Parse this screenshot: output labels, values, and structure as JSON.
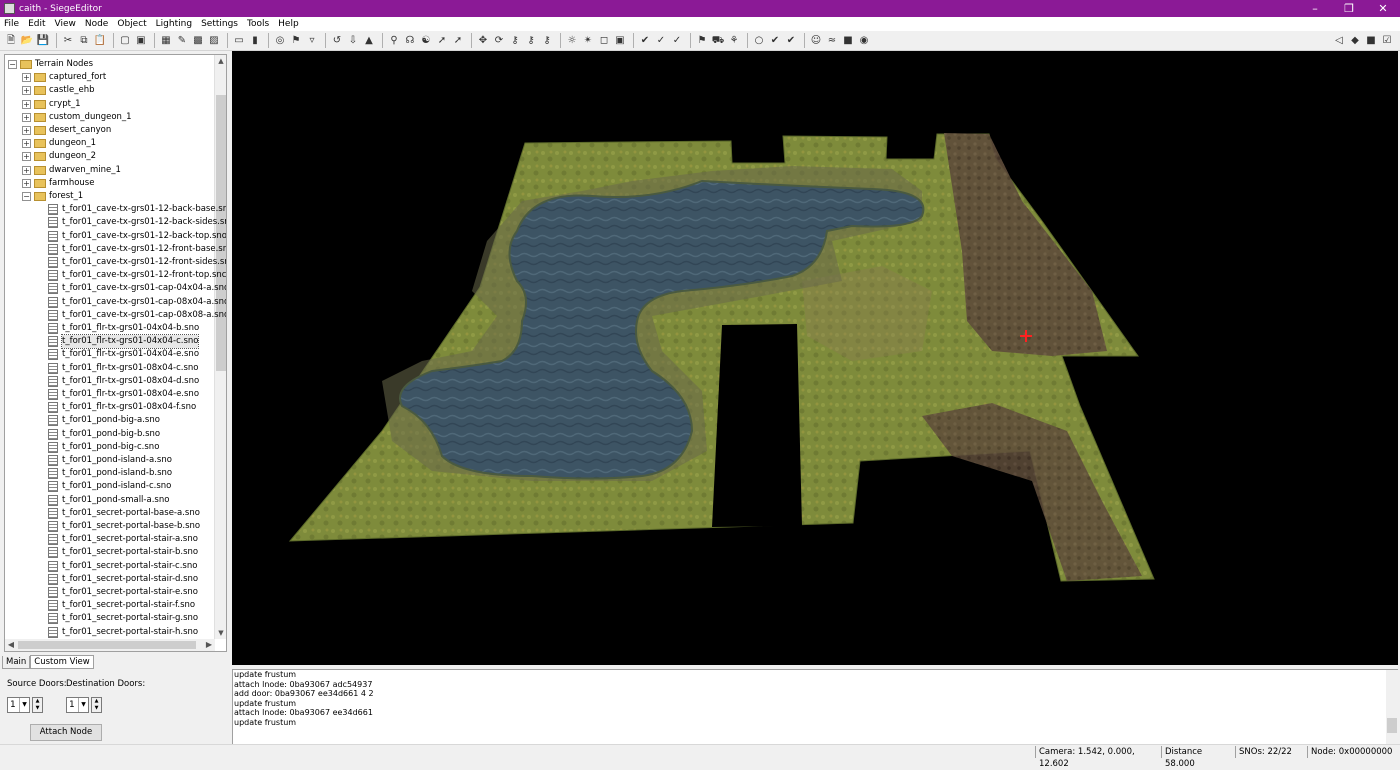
{
  "window": {
    "title": "caith - SiegeEditor"
  },
  "menu": [
    "File",
    "Edit",
    "View",
    "Node",
    "Object",
    "Lighting",
    "Settings",
    "Tools",
    "Help"
  ],
  "tree": {
    "root": "Terrain Nodes",
    "folders": [
      "captured_fort",
      "castle_ehb",
      "crypt_1",
      "custom_dungeon_1",
      "desert_canyon",
      "dungeon_1",
      "dungeon_2",
      "dwarven_mine_1",
      "farmhouse"
    ],
    "open_folder": "forest_1",
    "files": [
      "t_for01_cave-tx-grs01-12-back-base.sn",
      "t_for01_cave-tx-grs01-12-back-sides.sr",
      "t_for01_cave-tx-grs01-12-back-top.sno",
      "t_for01_cave-tx-grs01-12-front-base.sn",
      "t_for01_cave-tx-grs01-12-front-sides.sr",
      "t_for01_cave-tx-grs01-12-front-top.snc",
      "t_for01_cave-tx-grs01-cap-04x04-a.sno",
      "t_for01_cave-tx-grs01-cap-08x04-a.sno",
      "t_for01_cave-tx-grs01-cap-08x08-a.sno",
      "t_for01_flr-tx-grs01-04x04-b.sno",
      "t_for01_flr-tx-grs01-04x04-c.sno",
      "t_for01_flr-tx-grs01-04x04-e.sno",
      "t_for01_flr-tx-grs01-08x04-c.sno",
      "t_for01_flr-tx-grs01-08x04-d.sno",
      "t_for01_flr-tx-grs01-08x04-e.sno",
      "t_for01_flr-tx-grs01-08x04-f.sno",
      "t_for01_pond-big-a.sno",
      "t_for01_pond-big-b.sno",
      "t_for01_pond-big-c.sno",
      "t_for01_pond-island-a.sno",
      "t_for01_pond-island-b.sno",
      "t_for01_pond-island-c.sno",
      "t_for01_pond-small-a.sno",
      "t_for01_secret-portal-base-a.sno",
      "t_for01_secret-portal-base-b.sno",
      "t_for01_secret-portal-stair-a.sno",
      "t_for01_secret-portal-stair-b.sno",
      "t_for01_secret-portal-stair-c.sno",
      "t_for01_secret-portal-stair-d.sno",
      "t_for01_secret-portal-stair-e.sno",
      "t_for01_secret-portal-stair-f.sno",
      "t_for01_secret-portal-stair-g.sno",
      "t_for01_secret-portal-stair-h.sno"
    ],
    "selected_file": "t_for01_flr-tx-grs01-04x04-c.sno"
  },
  "tabs": [
    "Main",
    "Custom View"
  ],
  "active_tab": "Custom View",
  "doors": {
    "source_label": "Source Doors:",
    "dest_label": "Destination Doors:",
    "source_value": "1",
    "dest_value": "1",
    "attach_label": "Attach Node"
  },
  "log": [
    "update frustum",
    "attach lnode: 0ba93067 adc54937",
    "add door: 0ba93067 ee34d661 4 2",
    "update frustum",
    "attach lnode: 0ba93067 ee34d661",
    "update frustum"
  ],
  "status": {
    "camera": "Camera: 1.542, 0.000, 12.602",
    "distance": "Distance 58.000",
    "snos": "SNOs: 22/22",
    "node": "Node: 0x00000000"
  },
  "colors": {
    "titlebar": "#8b1a96",
    "grass": "#7d8a3a",
    "water": "#3a5060",
    "dirt": "#5a4a38",
    "cursor": "#ff2020"
  }
}
